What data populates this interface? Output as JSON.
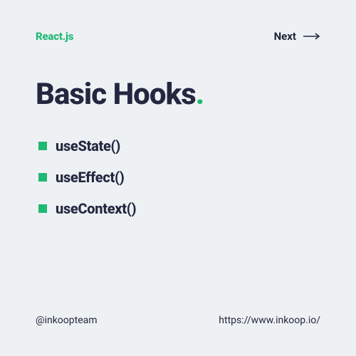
{
  "header": {
    "brand": "React.js",
    "next_label": "Next"
  },
  "title": {
    "text": "Basic Hooks",
    "dot": "."
  },
  "hooks": [
    {
      "name": "useState()"
    },
    {
      "name": "useEffect()"
    },
    {
      "name": "useContext()"
    }
  ],
  "footer": {
    "handle": "@inkoopteam",
    "url": "https://www.inkoop.io/"
  },
  "colors": {
    "accent": "#1fb974",
    "text": "#232840",
    "bg": "#eef1f4"
  }
}
